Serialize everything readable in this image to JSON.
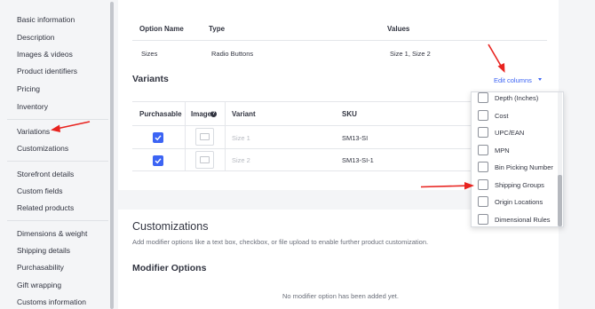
{
  "sidebar": {
    "items": [
      {
        "label": "Basic information"
      },
      {
        "label": "Description"
      },
      {
        "label": "Images & videos"
      },
      {
        "label": "Product identifiers"
      },
      {
        "label": "Pricing"
      },
      {
        "label": "Inventory"
      },
      {
        "label": "Variations"
      },
      {
        "label": "Customizations"
      },
      {
        "label": "Storefront details"
      },
      {
        "label": "Custom fields"
      },
      {
        "label": "Related products"
      },
      {
        "label": "Dimensions & weight"
      },
      {
        "label": "Shipping details"
      },
      {
        "label": "Purchasability"
      },
      {
        "label": "Gift wrapping"
      },
      {
        "label": "Customs information"
      }
    ]
  },
  "options_table": {
    "headers": {
      "name": "Option Name",
      "type": "Type",
      "values": "Values"
    },
    "rows": [
      {
        "name": "Sizes",
        "type": "Radio Buttons",
        "values": "Size 1, Size 2"
      }
    ]
  },
  "variants": {
    "title": "Variants",
    "edit_columns": "Edit columns",
    "headers": {
      "purchasable": "Purchasable",
      "image": "Image",
      "variant": "Variant",
      "sku": "SKU"
    },
    "help_icon": "?",
    "rows": [
      {
        "purchasable": true,
        "variant_placeholder": "Size 1",
        "sku": "SM13-SI"
      },
      {
        "purchasable": true,
        "variant_placeholder": "Size 2",
        "sku": "SM13-SI-1"
      }
    ]
  },
  "columns_dropdown": {
    "items": [
      {
        "label": "Depth (Inches)",
        "checked": false
      },
      {
        "label": "Cost",
        "checked": false
      },
      {
        "label": "UPC/EAN",
        "checked": false
      },
      {
        "label": "MPN",
        "checked": false
      },
      {
        "label": "Bin Picking Number",
        "checked": false
      },
      {
        "label": "Shipping Groups",
        "checked": false
      },
      {
        "label": "Origin Locations",
        "checked": false
      },
      {
        "label": "Dimensional Rules",
        "checked": false
      }
    ]
  },
  "customizations": {
    "title": "Customizations",
    "description": "Add modifier options like a text box, checkbox, or file upload to enable further product customization.",
    "modifier_title": "Modifier Options",
    "empty_text": "No modifier option has been added yet."
  },
  "colors": {
    "accent": "#3c64f4",
    "annotation": "#e8231f"
  }
}
